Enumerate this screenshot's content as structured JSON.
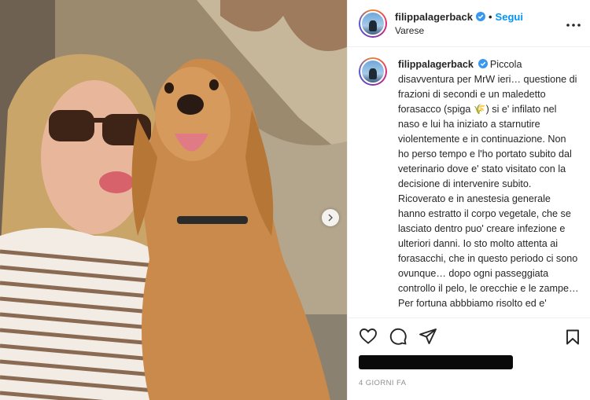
{
  "post": {
    "username": "filippalagerback",
    "follow_label": "Segui",
    "location": "Varese",
    "more_icon": "more-horizontal-icon",
    "caption": "Piccola disavventura per MrW ieri… questione di frazioni di secondi e un maledetto forasacco (spiga 🌾) si e' infilato nel naso e lui ha iniziato a starnutire violentemente e in continuazione. Non ho perso tempo e l'ho portato subito dal veterinario dove e' stato visitato con la decisione di intervenire subito. Ricoverato e in anestesia generale hanno estratto il corpo vegetale, che se lasciato dentro puo' creare infezione e ulteriori danni. Io sto molto attenta ai forasacchi, che in questo periodo ci sono ovunque… dopo ogni passeggiata controllo il pelo, le orecchie e le zampe… Per fortuna abbbiamo risolto ed e'",
    "timestamp": "4 GIORNI FA"
  },
  "colors": {
    "follow": "#0095f6",
    "verified": "#3897f0",
    "text": "#262626",
    "muted": "#8e8e8e"
  }
}
